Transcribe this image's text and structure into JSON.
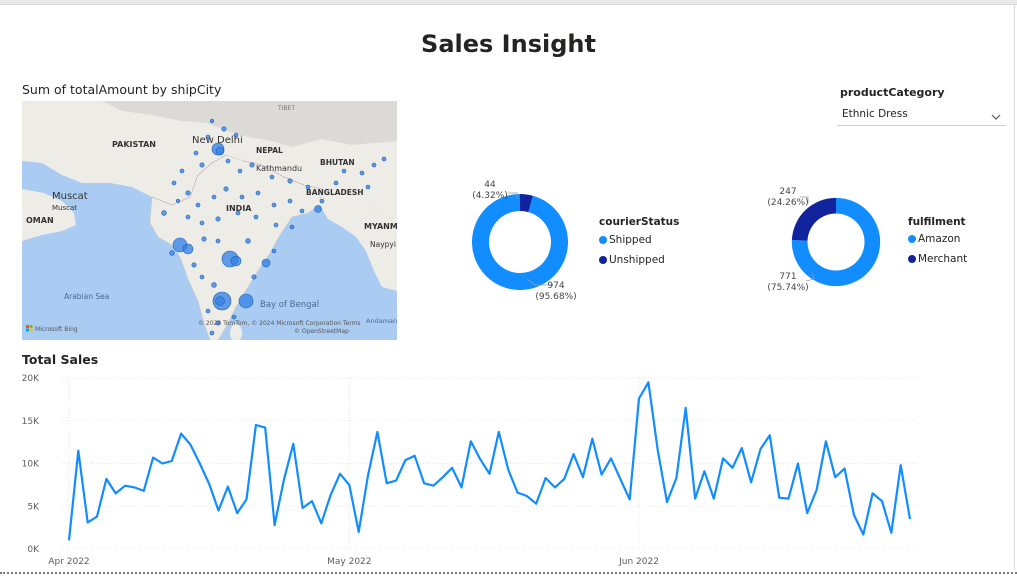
{
  "page": {
    "title": "Sales Insight"
  },
  "map": {
    "title": "Sum of totalAmount by shipCity",
    "labels": [
      "TIBET",
      "PAKISTAN",
      "New Delhi",
      "NEPAL",
      "Kathmandu",
      "BHUTAN",
      "Muscat",
      "Muscat",
      "BANGLADESH",
      "INDIA",
      "OMAN",
      "MYANM",
      "Naypyi",
      "Arabian Sea",
      "Bay of Bengal",
      "Andaman Sea"
    ],
    "attribution": "© 2024 TomTom, © 2024 Microsoft Corporation  Terms",
    "attribution2": "© OpenStreetMap",
    "brand": "Microsoft Bing",
    "colors": {
      "water": "#aacbf2",
      "land": "#eeece7",
      "highland": "#dcdad6",
      "bubble": "#2f7fe6"
    }
  },
  "slicer": {
    "label": "productCategory",
    "value": "Ethnic Dress"
  },
  "courier_status": {
    "legend_title": "courierStatus",
    "items": [
      {
        "name": "Shipped",
        "value": 974,
        "pct": "(95.68%)",
        "color": "#118dff"
      },
      {
        "name": "Unshipped",
        "value": 44,
        "pct": "(4.32%)",
        "color": "#12239e"
      }
    ]
  },
  "fulfilment": {
    "legend_title": "fulfilment",
    "items": [
      {
        "name": "Amazon",
        "value": 771,
        "pct": "(75.74%)",
        "color": "#118dff"
      },
      {
        "name": "Merchant",
        "value": 247,
        "pct": "(24.26%)",
        "color": "#12239e"
      }
    ]
  },
  "chart_data": {
    "type": "line",
    "title": "Total Sales",
    "ylim": [
      0,
      20000
    ],
    "yticks": [
      "0K",
      "5K",
      "10K",
      "15K",
      "20K"
    ],
    "ytick_values": [
      0,
      5000,
      10000,
      15000,
      20000
    ],
    "x_ticks": [
      {
        "label": "Apr 2022",
        "index": 0
      },
      {
        "label": "May 2022",
        "index": 30
      },
      {
        "label": "Jun 2022",
        "index": 61
      }
    ],
    "x_start": "2022-04-01",
    "x_end": "2022-06-29",
    "series": [
      {
        "color": "#118dff",
        "values": [
          1000,
          11500,
          3100,
          3800,
          8200,
          6500,
          7400,
          7200,
          6800,
          10700,
          10000,
          10300,
          13500,
          12200,
          10000,
          7600,
          4500,
          7300,
          4200,
          5800,
          14500,
          14200,
          2800,
          8100,
          12300,
          4800,
          5600,
          3000,
          6300,
          8800,
          7500,
          2000,
          8600,
          13700,
          7700,
          8000,
          10400,
          10900,
          7700,
          7400,
          8400,
          9500,
          7200,
          12600,
          10500,
          8800,
          13700,
          9300,
          6600,
          6200,
          5300,
          8300,
          7200,
          8200,
          11100,
          8400,
          12900,
          8700,
          10600,
          8200,
          5800,
          17600,
          19500,
          11600,
          5500,
          8300,
          16500,
          5900,
          9100,
          5900,
          10600,
          9500,
          11800,
          7800,
          11700,
          13300,
          6000,
          5900,
          10000,
          4200,
          6900,
          12600,
          8400,
          9400,
          4000,
          1700,
          6500,
          5600,
          1900,
          9800,
          3500
        ]
      }
    ]
  }
}
